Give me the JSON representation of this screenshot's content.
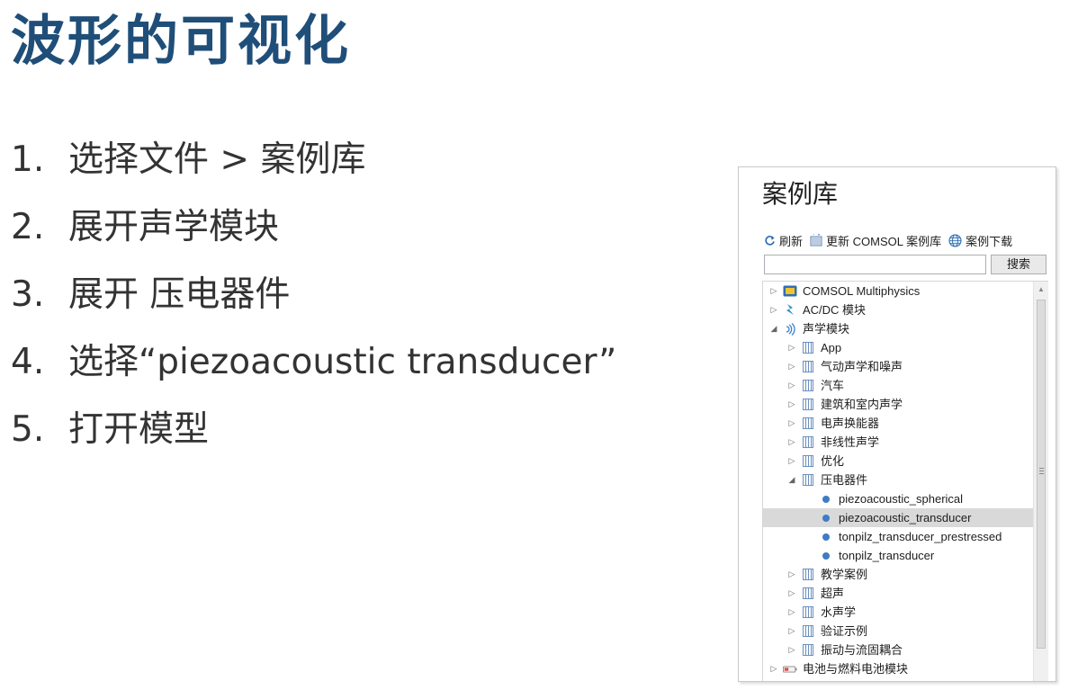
{
  "slide": {
    "title": "波形的可视化",
    "steps": [
      {
        "num": "1.",
        "text": "选择文件 > 案例库"
      },
      {
        "num": "2.",
        "text": "展开声学模块"
      },
      {
        "num": "3.",
        "text": "展开 压电器件"
      },
      {
        "num": "4.",
        "text": "选择“piezoacoustic transducer”"
      },
      {
        "num": "5.",
        "text": "打开模型"
      }
    ]
  },
  "panel": {
    "title": "案例库",
    "toolbar": {
      "refresh": "刷新",
      "update": "更新 COMSOL 案例库",
      "download": "案例下载"
    },
    "search": {
      "value": "",
      "button": "搜索"
    },
    "tree": [
      {
        "label": "COMSOL Multiphysics",
        "level": 0,
        "state": "collapsed",
        "icon": "comsol-icon"
      },
      {
        "label": "AC/DC 模块",
        "level": 0,
        "state": "collapsed",
        "icon": "acdc-icon"
      },
      {
        "label": "声学模块",
        "level": 0,
        "state": "expanded",
        "icon": "acoustics-icon"
      },
      {
        "label": "App",
        "level": 1,
        "state": "collapsed",
        "icon": "library-icon"
      },
      {
        "label": "气动声学和噪声",
        "level": 1,
        "state": "collapsed",
        "icon": "library-icon"
      },
      {
        "label": "汽车",
        "level": 1,
        "state": "collapsed",
        "icon": "library-icon"
      },
      {
        "label": "建筑和室内声学",
        "level": 1,
        "state": "collapsed",
        "icon": "library-icon"
      },
      {
        "label": "电声换能器",
        "level": 1,
        "state": "collapsed",
        "icon": "library-icon"
      },
      {
        "label": "非线性声学",
        "level": 1,
        "state": "collapsed",
        "icon": "library-icon"
      },
      {
        "label": "优化",
        "level": 1,
        "state": "collapsed",
        "icon": "library-icon"
      },
      {
        "label": "压电器件",
        "level": 1,
        "state": "expanded",
        "icon": "library-icon"
      },
      {
        "label": "piezoacoustic_spherical",
        "level": 2,
        "state": "leaf",
        "icon": "model-dot-icon"
      },
      {
        "label": "piezoacoustic_transducer",
        "level": 2,
        "state": "leaf",
        "icon": "model-dot-icon",
        "selected": true
      },
      {
        "label": "tonpilz_transducer_prestressed",
        "level": 2,
        "state": "leaf",
        "icon": "model-dot-icon"
      },
      {
        "label": "tonpilz_transducer",
        "level": 2,
        "state": "leaf",
        "icon": "model-dot-icon"
      },
      {
        "label": "教学案例",
        "level": 1,
        "state": "collapsed",
        "icon": "library-icon"
      },
      {
        "label": "超声",
        "level": 1,
        "state": "collapsed",
        "icon": "library-icon"
      },
      {
        "label": "水声学",
        "level": 1,
        "state": "collapsed",
        "icon": "library-icon"
      },
      {
        "label": "验证示例",
        "level": 1,
        "state": "collapsed",
        "icon": "library-icon"
      },
      {
        "label": "振动与流固耦合",
        "level": 1,
        "state": "collapsed",
        "icon": "library-icon"
      },
      {
        "label": "电池与燃料电池模块",
        "level": 0,
        "state": "collapsed",
        "icon": "battery-icon"
      }
    ],
    "colors": {
      "title": "#1f4e79",
      "selection": "#d9d9d9",
      "model_dot": "#3e7cc4"
    }
  }
}
